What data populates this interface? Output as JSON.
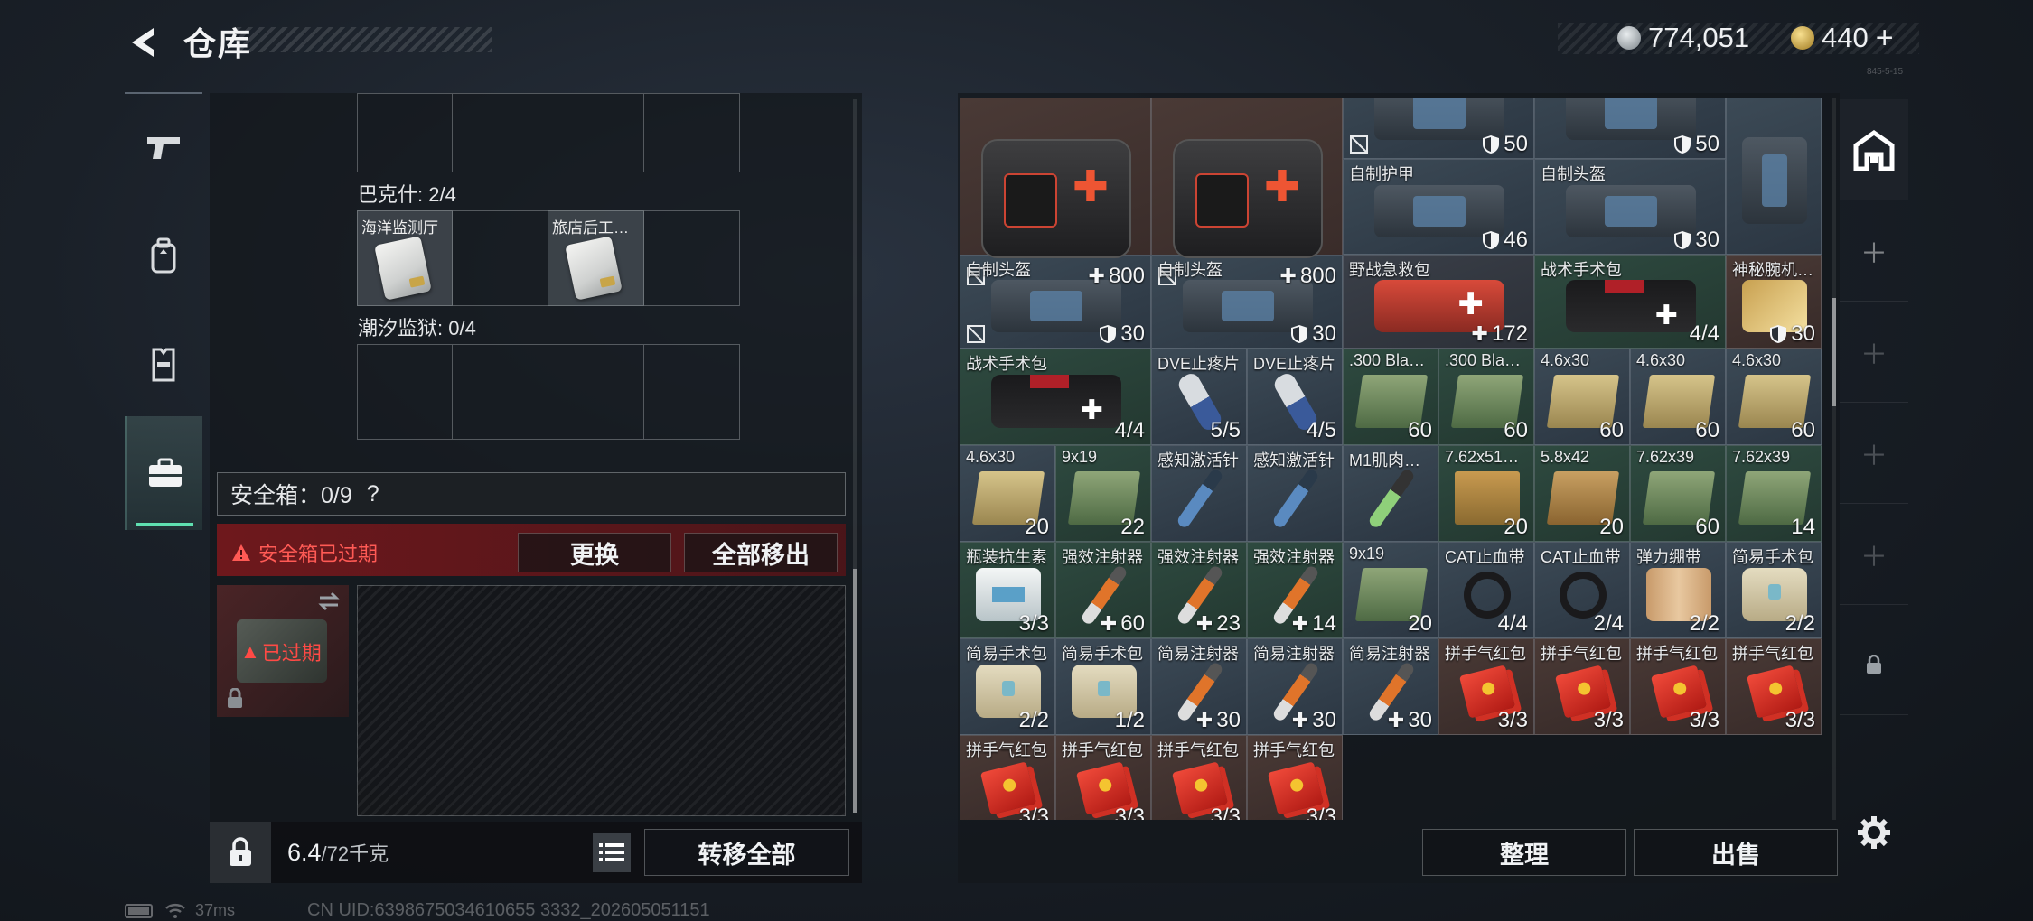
{
  "header": {
    "title": "仓库",
    "currency_silver": "774,051",
    "currency_gold": "440",
    "gold_plus": "+",
    "version": "845-5-15"
  },
  "left_rail": {
    "tabs": [
      {
        "icon": "pistol-icon"
      },
      {
        "icon": "backpack-icon"
      },
      {
        "icon": "vest-icon"
      },
      {
        "icon": "briefcase-icon",
        "active": true
      }
    ]
  },
  "collections": [
    {
      "label": "巴克什: 2/4",
      "items": [
        "海洋监测厅",
        "",
        "旅店后工…",
        ""
      ]
    },
    {
      "label": "潮汐监狱: 0/4",
      "items": [
        "",
        "",
        "",
        ""
      ]
    }
  ],
  "safe": {
    "header": "安全箱：0/9",
    "help": "?",
    "expired_msg": "安全箱已过期",
    "replace_btn": "更换",
    "move_all_out_btn": "全部移出",
    "expired_badge": "已过期"
  },
  "bottom": {
    "weight": "6.4",
    "weight_cap": "/72千克",
    "transfer_all": "转移全部"
  },
  "inventory": [
    {
      "name": "",
      "count": "800",
      "plus": true,
      "noicon": true,
      "art": "medkit",
      "q": 2
    },
    {
      "name": "",
      "count": "800",
      "plus": true,
      "noicon": true,
      "art": "medkit",
      "q": 2
    },
    {
      "name": "",
      "count": "50",
      "shield": true,
      "noicon": true,
      "art": "armor",
      "q": 0
    },
    {
      "name": "",
      "count": "50",
      "shield": true,
      "art": "armor",
      "q": 0
    },
    {
      "name": "",
      "count": "",
      "art": "armor",
      "q": 0
    },
    {
      "name": "自制护甲",
      "count": "46",
      "shield": true,
      "art": "armor",
      "q": 0
    },
    {
      "name": "自制头盔",
      "count": "30",
      "shield": true,
      "art": "armor",
      "q": 0
    },
    {
      "name": "",
      "count": "30",
      "shield": true,
      "art": "armor",
      "q": 0
    },
    {
      "name": "自制头盔",
      "count": "30",
      "shield": true,
      "noicon": true,
      "art": "armor",
      "q": 0
    },
    {
      "name": "自制头盔",
      "count": "30",
      "shield": true,
      "art": "armor",
      "q": 0
    },
    {
      "name": "野战急救包",
      "count": "172",
      "plus": true,
      "art": "redkit",
      "q": 3
    },
    {
      "name": "战术手术包",
      "count": "4/4",
      "art": "blackbag",
      "q": 1
    },
    {
      "name": "神秘腕机…",
      "count": "",
      "art": "watch",
      "q": 2
    },
    {
      "name": "战术手术包",
      "count": "4/4",
      "art": "blackbag",
      "q": 1
    },
    {
      "name": "DVE止疼片",
      "count": "5/5",
      "art": "pill",
      "q": 0
    },
    {
      "name": "DVE止疼片",
      "count": "4/5",
      "art": "pill",
      "q": 0
    },
    {
      "name": ".300 Bla…",
      "count": "60",
      "art": "ammo-g",
      "q": 1
    },
    {
      "name": ".300 Bla…",
      "count": "60",
      "art": "ammo-g",
      "q": 1
    },
    {
      "name": "4.6x30",
      "count": "60",
      "art": "ammo-y",
      "q": 0
    },
    {
      "name": "4.6x30",
      "count": "60",
      "art": "ammo-y",
      "q": 0
    },
    {
      "name": "4.6x30",
      "count": "60",
      "art": "ammo-y",
      "q": 0
    },
    {
      "name": "4.6x30",
      "count": "20",
      "art": "ammo-y",
      "q": 0
    },
    {
      "name": "9x19",
      "count": "22",
      "art": "ammo-g",
      "q": 1
    },
    {
      "name": "感知激活针",
      "count": "",
      "art": "syringe blue",
      "q": 0
    },
    {
      "name": "感知激活针",
      "count": "",
      "art": "syringe blue",
      "q": 0
    },
    {
      "name": "M1肌肉…",
      "count": "",
      "art": "syringe green",
      "q": 0
    },
    {
      "name": "7.62x51…",
      "count": "20",
      "art": "box-tan",
      "q": 1
    },
    {
      "name": "5.8x42",
      "count": "20",
      "art": "ammo-tan",
      "q": 1
    },
    {
      "name": "7.62x39",
      "count": "60",
      "art": "ammo-g",
      "q": 1
    },
    {
      "name": "7.62x39",
      "count": "14",
      "art": "ammo-g",
      "q": 1
    },
    {
      "name": "瓶装抗生素",
      "count": "3/3",
      "art": "bottle",
      "q": 1
    },
    {
      "name": "强效注射器",
      "count": "60",
      "plus": true,
      "art": "syringe",
      "q": 1
    },
    {
      "name": "强效注射器",
      "count": "23",
      "plus": true,
      "art": "syringe",
      "q": 1
    },
    {
      "name": "强效注射器",
      "count": "14",
      "plus": true,
      "art": "syringe",
      "q": 1
    },
    {
      "name": "9x19",
      "count": "20",
      "art": "ammo-g",
      "q": 0
    },
    {
      "name": "CAT止血带",
      "count": "4/4",
      "art": "tourniquet",
      "q": 0
    },
    {
      "name": "CAT止血带",
      "count": "2/4",
      "art": "tourniquet",
      "q": 0
    },
    {
      "name": "弹力绷带",
      "count": "2/2",
      "art": "bandage",
      "q": 0
    },
    {
      "name": "简易手术包",
      "count": "2/2",
      "art": "pouch",
      "q": 0
    },
    {
      "name": "简易手术包",
      "count": "2/2",
      "art": "pouch",
      "q": 0
    },
    {
      "name": "简易手术包",
      "count": "1/2",
      "art": "pouch",
      "q": 0
    },
    {
      "name": "简易注射器",
      "count": "30",
      "plus": true,
      "art": "syringe",
      "q": 0
    },
    {
      "name": "简易注射器",
      "count": "30",
      "plus": true,
      "art": "syringe",
      "q": 0
    },
    {
      "name": "简易注射器",
      "count": "30",
      "plus": true,
      "art": "syringe",
      "q": 0
    },
    {
      "name": "拼手气红包",
      "count": "3/3",
      "art": "envelope",
      "q": 2
    },
    {
      "name": "拼手气红包",
      "count": "3/3",
      "art": "envelope",
      "q": 2
    },
    {
      "name": "拼手气红包",
      "count": "3/3",
      "art": "envelope",
      "q": 2
    },
    {
      "name": "拼手气红包",
      "count": "3/3",
      "art": "envelope",
      "q": 2
    },
    {
      "name": "拼手气红包",
      "count": "3/3",
      "art": "envelope",
      "q": 2
    },
    {
      "name": "拼手气红包",
      "count": "3/3",
      "art": "envelope",
      "q": 2
    },
    {
      "name": "拼手气红包",
      "count": "3/3",
      "art": "envelope",
      "q": 2
    },
    {
      "name": "拼手气红包",
      "count": "3/3",
      "art": "envelope",
      "q": 2
    }
  ],
  "actions": {
    "sort": "整理",
    "sell": "出售"
  },
  "status": {
    "ping": "37ms",
    "uid": "CN UID:6398675034610655 3332_202605051151"
  },
  "colors": {
    "accent_green": "#5fe0b0",
    "expired_red": "#ff5a55"
  }
}
